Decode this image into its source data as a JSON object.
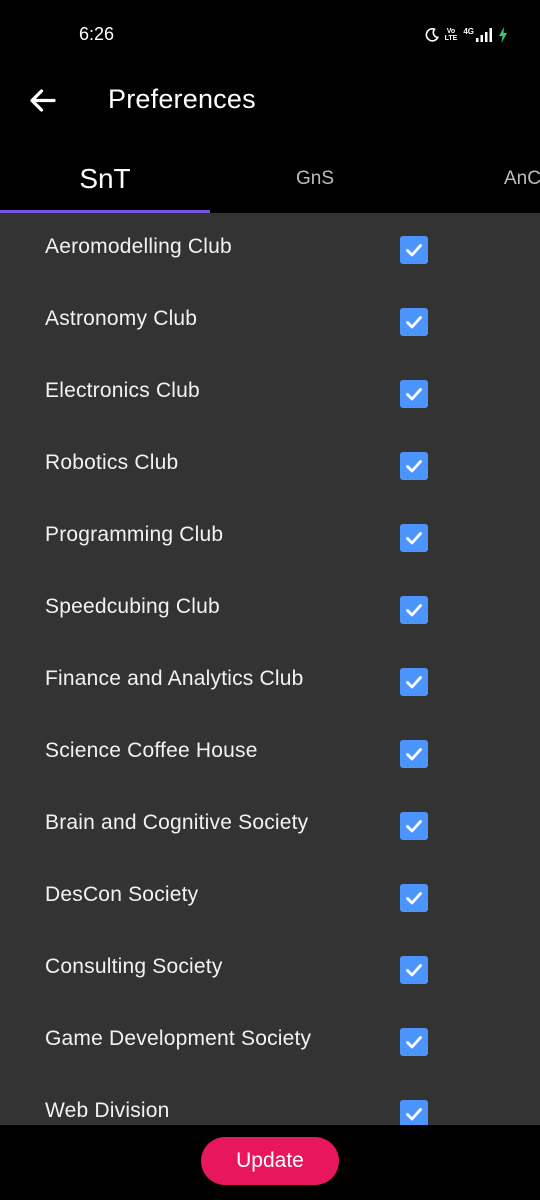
{
  "status_bar": {
    "time": "6:26",
    "icons": [
      "moon-icon",
      "volte-icon",
      "4g-signal-icon",
      "battery-charging-icon"
    ],
    "volte_top": "Vo",
    "volte_bottom": "LTE",
    "network": "4G"
  },
  "app_bar": {
    "title": "Preferences",
    "back_icon": "arrow-left-icon"
  },
  "tabs": [
    {
      "label": "SnT",
      "active": true
    },
    {
      "label": "GnS",
      "active": false
    },
    {
      "label": "AnC",
      "active": false
    }
  ],
  "colors": {
    "tab_indicator": "#7b52e0",
    "checkbox": "#4c95ff",
    "update_button": "#e8175d",
    "list_background": "#333333"
  },
  "preferences": [
    {
      "label": "Aeromodelling Club",
      "checked": true
    },
    {
      "label": "Astronomy Club",
      "checked": true
    },
    {
      "label": "Electronics Club",
      "checked": true
    },
    {
      "label": "Robotics Club",
      "checked": true
    },
    {
      "label": "Programming Club",
      "checked": true
    },
    {
      "label": "Speedcubing Club",
      "checked": true
    },
    {
      "label": "Finance and Analytics Club",
      "checked": true
    },
    {
      "label": "Science Coffee House",
      "checked": true
    },
    {
      "label": "Brain and Cognitive Society",
      "checked": true
    },
    {
      "label": "DesCon Society",
      "checked": true
    },
    {
      "label": "Consulting Society",
      "checked": true
    },
    {
      "label": "Game Development Society",
      "checked": true
    },
    {
      "label": "Web Division",
      "checked": true
    }
  ],
  "footer": {
    "update_label": "Update"
  }
}
